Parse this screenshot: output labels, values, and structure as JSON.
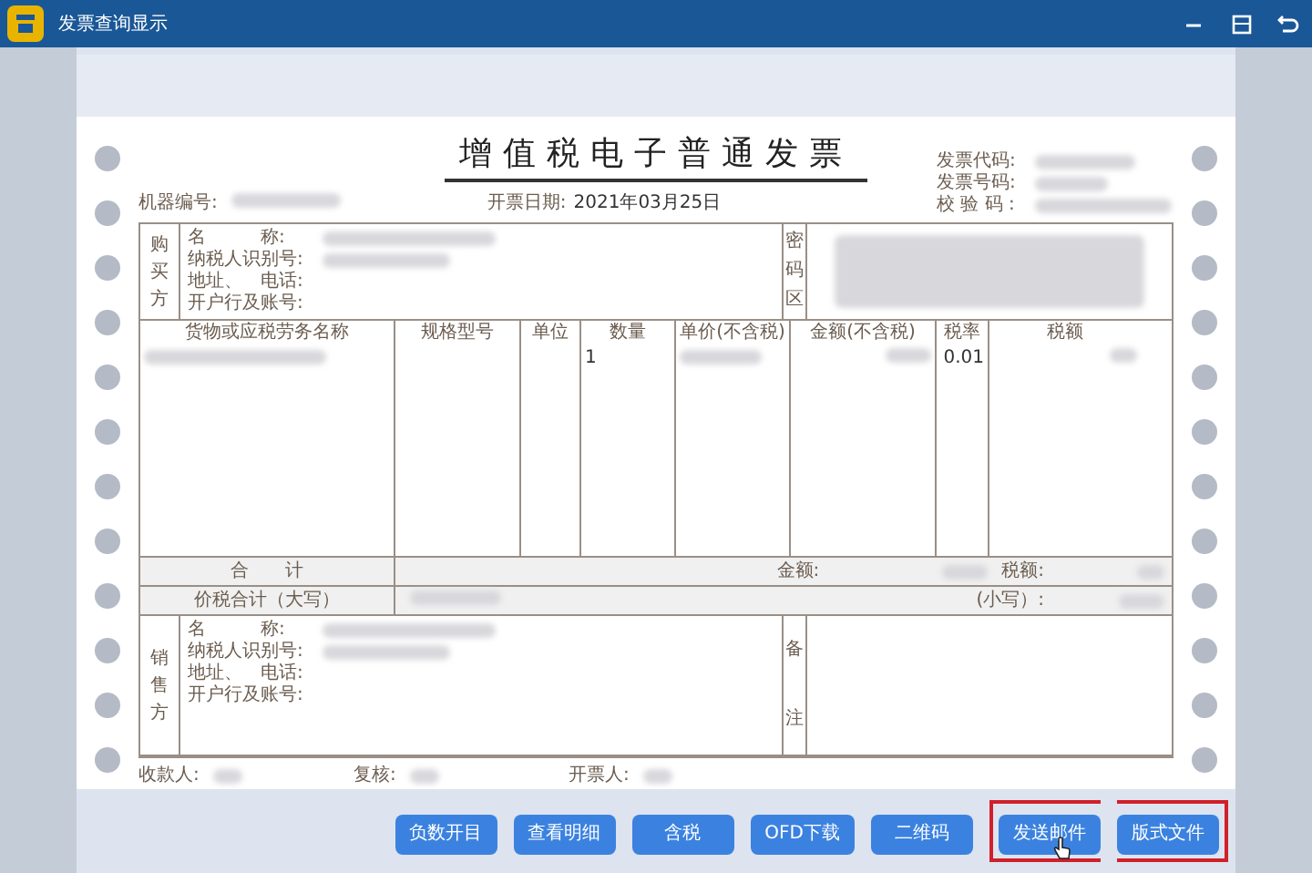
{
  "window": {
    "title": "发票查询显示"
  },
  "invoice": {
    "title": "增值税电子普通发票",
    "codes": [
      {
        "label": "发票代码:"
      },
      {
        "label": "发票号码:"
      },
      {
        "label": "校 验 码 :"
      }
    ],
    "machine_no_label": "机器编号:",
    "date_label": "开票日期:",
    "date_value": "2021年03月25日",
    "buyer": {
      "section_label": "购买方",
      "fields": [
        "名　　　称:",
        "纳税人识别号:",
        "地址、　电话:",
        "开户行及账号:"
      ],
      "cipher_label": "密码区"
    },
    "goods": {
      "columns": [
        "货物或应税劳务名称",
        "规格型号",
        "单位",
        "数量",
        "单价(不含税)",
        "金额(不含税)",
        "税率",
        "税额"
      ],
      "rows": [
        {
          "quantity": "1",
          "tax_rate": "0.01"
        }
      ]
    },
    "total": {
      "label": "合　　计",
      "amount_label": "金额:",
      "tax_label": "税额:"
    },
    "total_with_tax": {
      "label": "价税合计（大写）",
      "small_label": "(小写）:"
    },
    "seller": {
      "section_label": "销售方",
      "fields": [
        "名　　　称:",
        "纳税人识别号:",
        "地址、　电话:",
        "开户行及账号:"
      ],
      "remarks_label": "备注"
    },
    "signatures": [
      "收款人:",
      "复核:",
      "开票人:"
    ]
  },
  "buttons": [
    {
      "label": "负数开目",
      "highlighted": false,
      "hovered": false
    },
    {
      "label": "查看明细",
      "highlighted": false,
      "hovered": false
    },
    {
      "label": "含税",
      "highlighted": false,
      "hovered": false
    },
    {
      "label": "OFD下载",
      "highlighted": false,
      "hovered": false
    },
    {
      "label": "二维码",
      "highlighted": false,
      "hovered": false
    },
    {
      "label": "发送邮件",
      "highlighted": true,
      "hovered": true
    },
    {
      "label": "版式文件",
      "highlighted": true,
      "hovered": false
    }
  ]
}
